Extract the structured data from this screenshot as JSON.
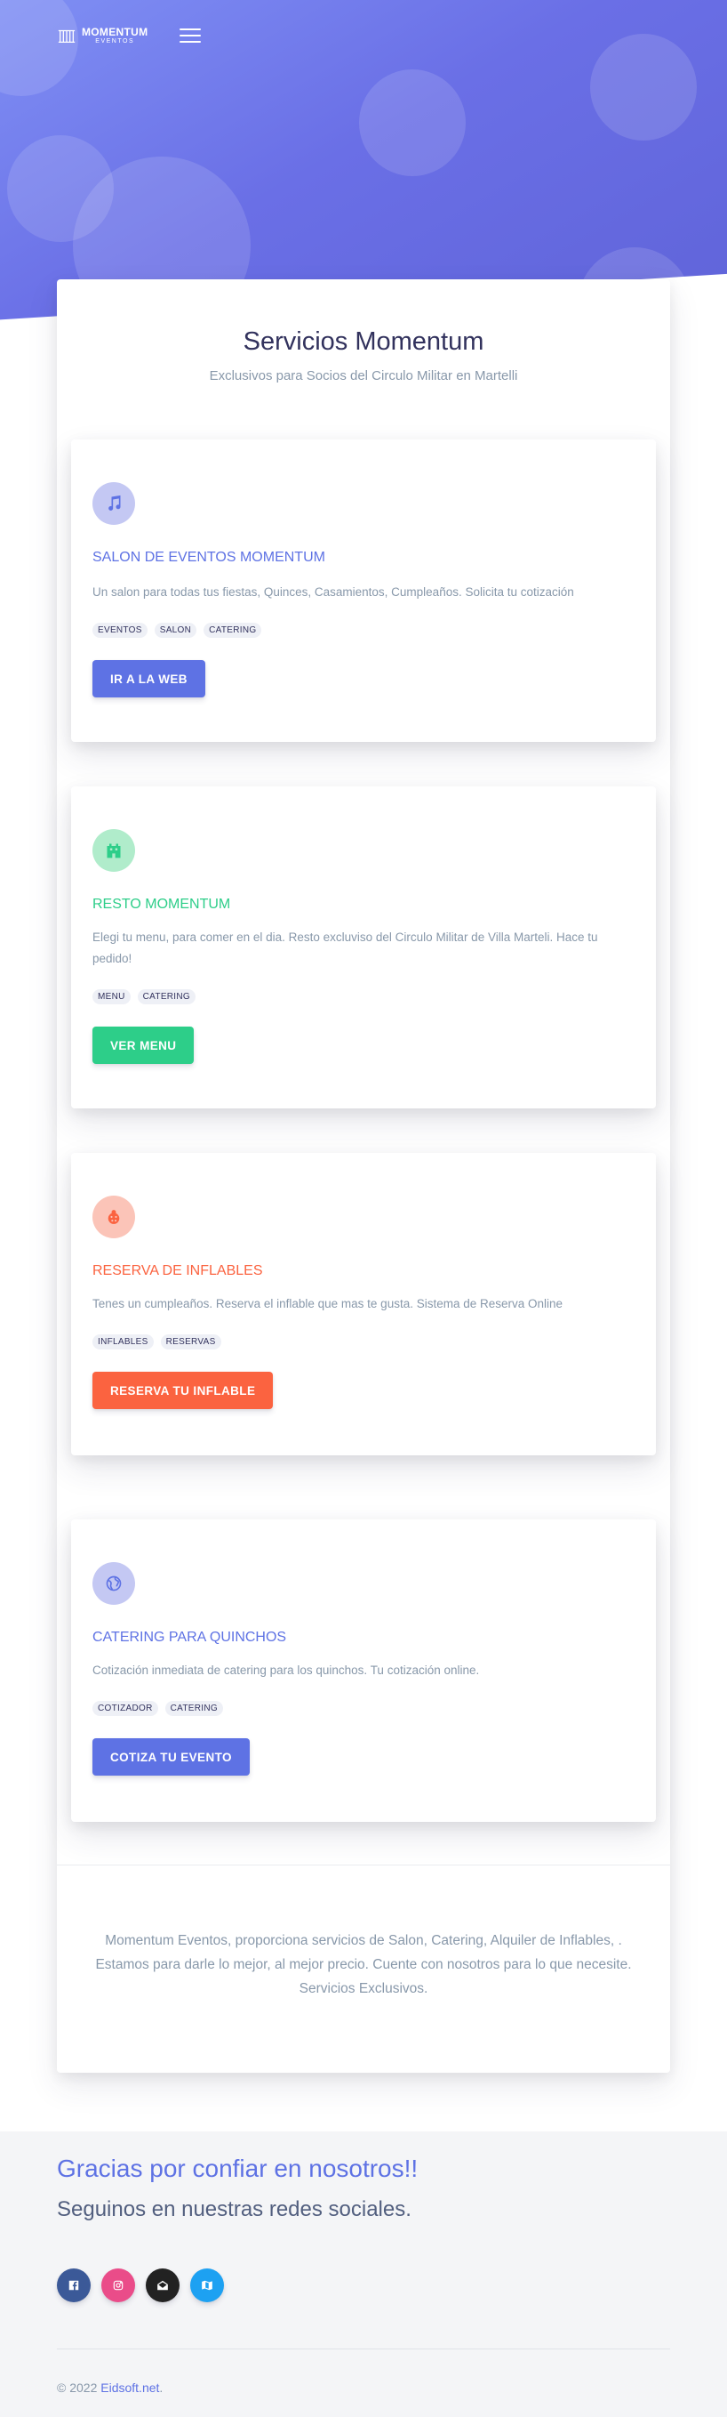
{
  "brand": {
    "name": "MOMENTUM",
    "subtitle": "EVENTOS",
    "menu_icon": "hamburger-menu-icon"
  },
  "main": {
    "title": "Servicios Momentum",
    "subtitle": "Exclusivos para Socios del Circulo Militar en Martelli",
    "services": [
      {
        "icon": "music-note-icon",
        "title": "SALON DE EVENTOS MOMENTUM",
        "description": "Un salon para todas tus fiestas, Quinces, Casamientos, Cumpleaños. Solicita tu cotización",
        "tags": [
          "EVENTOS",
          "SALON",
          "CATERING"
        ],
        "button": "IR A LA WEB",
        "color": "#5e72e4"
      },
      {
        "icon": "building-icon",
        "title": "RESTO MOMENTUM",
        "description": "Elegi tu menu, para comer en el dia. Resto excluviso del Circulo Militar de Villa Marteli. Hace tu pedido!",
        "tags": [
          "MENU",
          "CATERING"
        ],
        "button": "VER MENU",
        "color": "#2dce89"
      },
      {
        "icon": "ladybug-icon",
        "title": "RESERVA DE INFLABLES",
        "description": "Tenes un cumpleaños. Reserva el inflable que mas te gusta. Sistema de Reserva Online",
        "tags": [
          "INFLABLES",
          "RESERVAS"
        ],
        "button": "RESERVA TU INFLABLE",
        "color": "#fb6340"
      },
      {
        "icon": "globe-icon",
        "title": "CATERING PARA QUINCHOS",
        "description": "Cotización inmediata de catering para los quinchos. Tu cotización online.",
        "tags": [
          "COTIZADOR",
          "CATERING"
        ],
        "button": "COTIZA TU EVENTO",
        "color": "#5e72e4"
      }
    ],
    "closing": "Momentum Eventos, proporciona servicios de Salon, Catering, Alquiler de Inflables, . Estamos para darle lo mejor, al mejor precio. Cuente con nosotros para lo que necesite. Servicios Exclusivos."
  },
  "footer": {
    "thanks": "Gracias por confiar en nosotros!!",
    "follow": "Seguinos en nuestras redes sociales.",
    "socials": [
      {
        "icon": "facebook-icon",
        "color": "#3b5998"
      },
      {
        "icon": "instagram-icon",
        "color": "#ea4c89"
      },
      {
        "icon": "envelope-icon",
        "color": "#222222"
      },
      {
        "icon": "map-icon",
        "color": "#1da1f2"
      }
    ],
    "copyright_prefix": "© 2022 ",
    "copyright_link": "Eidsoft.net",
    "copyright_suffix": "."
  }
}
